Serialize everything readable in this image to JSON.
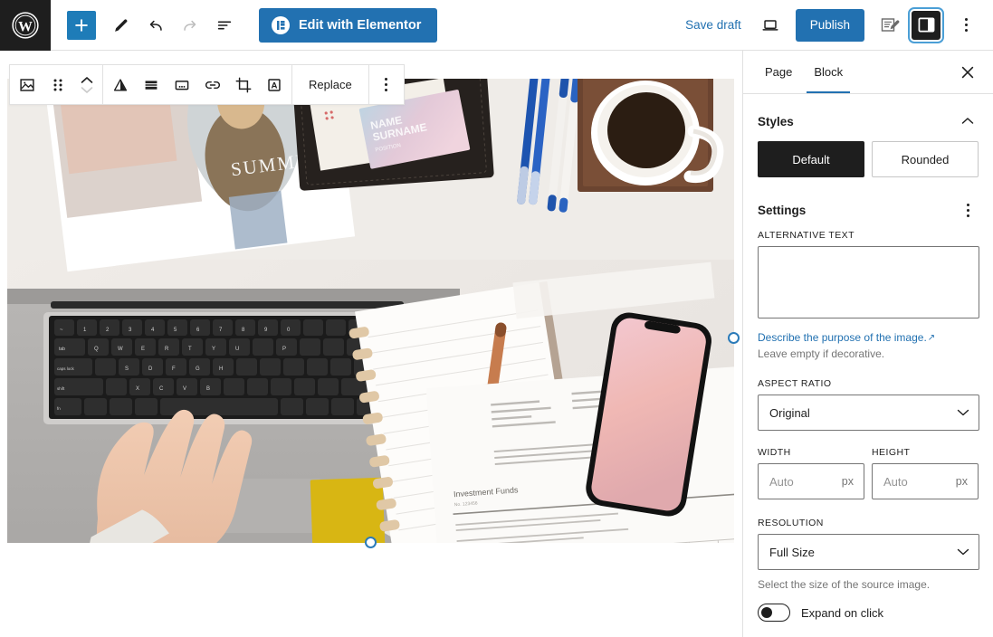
{
  "topbar": {
    "logo": "wordpress-logo",
    "add_block_label": "+",
    "edit_elementor_label": "Edit with Elementor",
    "save_draft_label": "Save draft",
    "publish_label": "Publish",
    "tools": [
      {
        "name": "add-block-button",
        "icon": "plus-icon"
      },
      {
        "name": "tools-edit-button",
        "icon": "pencil-icon"
      },
      {
        "name": "undo-button",
        "icon": "undo-arrow-icon"
      },
      {
        "name": "redo-button",
        "icon": "redo-arrow-icon"
      },
      {
        "name": "details-button",
        "icon": "list-view-icon"
      }
    ],
    "right_tools": [
      {
        "name": "preview-button",
        "icon": "laptop-icon"
      },
      {
        "name": "jetpack-button",
        "icon": "document-pencil-icon"
      },
      {
        "name": "settings-sidebar-toggle",
        "icon": "sidebar-panel-icon"
      },
      {
        "name": "options-menu-button",
        "icon": "kebab-icon"
      }
    ]
  },
  "block_toolbar": {
    "block_type_label": "image-block",
    "buttons": [
      {
        "name": "block-type-image-button",
        "icon": "image-icon"
      },
      {
        "name": "drag-handle",
        "icon": "drag-dots-icon"
      },
      {
        "name": "move-up-down-button",
        "icon": "chevron-up-down-icon"
      },
      {
        "name": "align-button",
        "icon": "align-triangle-icon"
      },
      {
        "name": "caption-position-button",
        "icon": "caption-bars-icon"
      },
      {
        "name": "add-caption-button",
        "icon": "caption-box-icon"
      },
      {
        "name": "link-button",
        "icon": "link-icon"
      },
      {
        "name": "crop-button",
        "icon": "crop-icon"
      },
      {
        "name": "text-overlay-button",
        "icon": "letter-a-box-icon"
      }
    ],
    "replace_label": "Replace",
    "more_options_name": "block-more-options"
  },
  "image_block": {
    "alt": "",
    "description": "Flat-lay photo of hands typing on a laptop surrounded by notebooks, pens, a coffee cup, a smartphone and printed financial documents",
    "handles": [
      "right-resize-handle",
      "bottom-resize-handle"
    ]
  },
  "sidebar": {
    "tabs": [
      {
        "label": "Page",
        "active": false
      },
      {
        "label": "Block",
        "active": true
      }
    ],
    "close_label": "×",
    "styles": {
      "title": "Styles",
      "options": [
        {
          "label": "Default",
          "selected": true
        },
        {
          "label": "Rounded",
          "selected": false
        }
      ]
    },
    "settings": {
      "title": "Settings",
      "alt_text_label": "ALTERNATIVE TEXT",
      "alt_text_value": "",
      "alt_text_placeholder": "",
      "help_link": "Describe the purpose of the image.",
      "help_note": "Leave empty if decorative.",
      "aspect_ratio_label": "ASPECT RATIO",
      "aspect_ratio_value": "Original",
      "width_label": "WIDTH",
      "width_value": "",
      "width_placeholder": "Auto",
      "width_unit": "px",
      "height_label": "HEIGHT",
      "height_value": "",
      "height_placeholder": "Auto",
      "height_unit": "px",
      "resolution_label": "RESOLUTION",
      "resolution_value": "Full Size",
      "resolution_help": "Select the size of the source image.",
      "expand_on_click_label": "Expand on click"
    }
  },
  "colors": {
    "accent": "#2271b1",
    "wp_black": "#1e1e1e",
    "border": "#e0e0e0",
    "muted": "#757575",
    "handle": "#2b7bb9"
  }
}
